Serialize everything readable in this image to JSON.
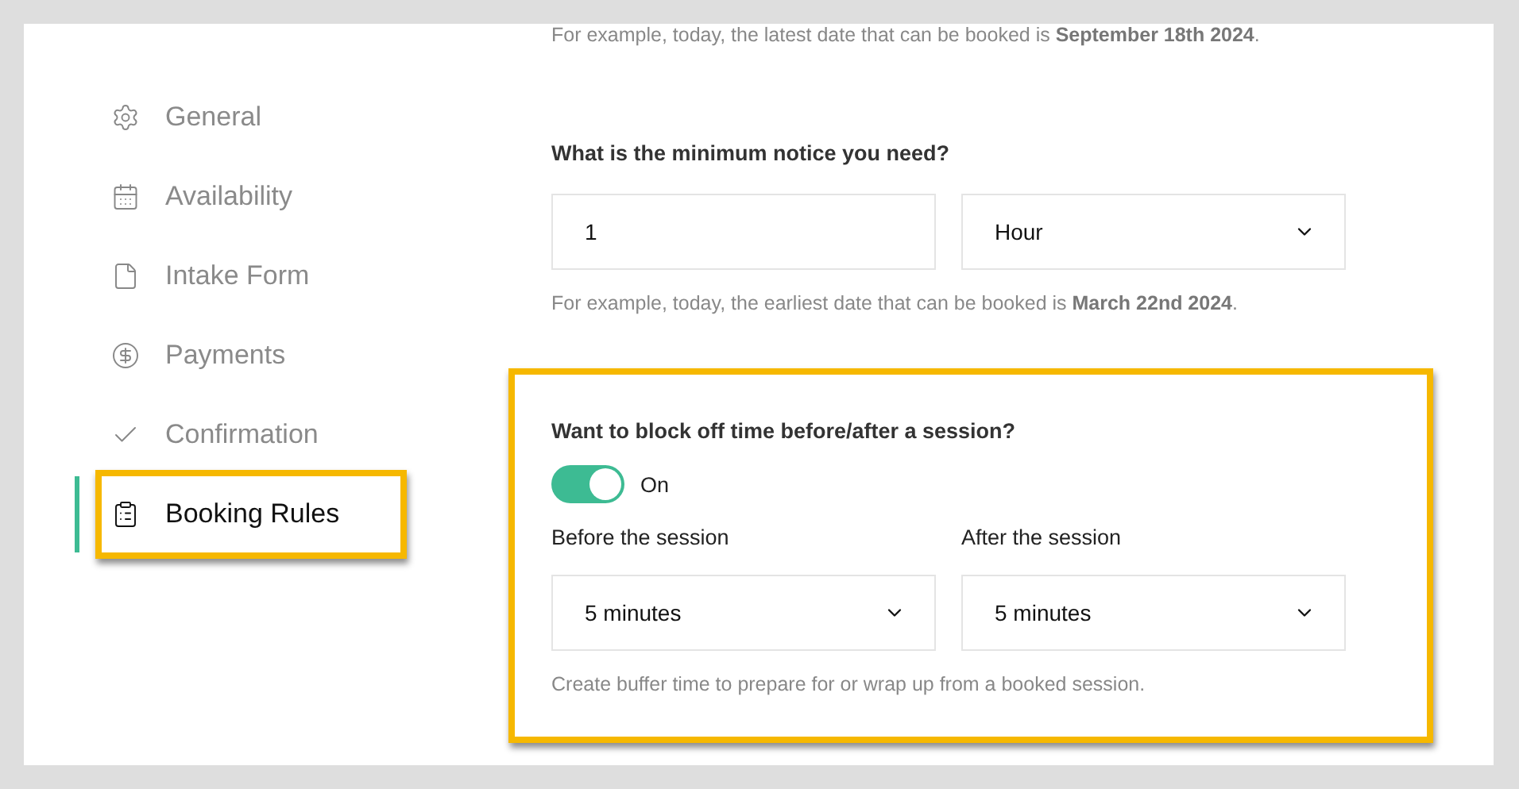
{
  "sidebar": {
    "items": [
      {
        "label": "General",
        "selected": false,
        "highlighted": false
      },
      {
        "label": "Availability",
        "selected": false,
        "highlighted": false
      },
      {
        "label": "Intake Form",
        "selected": false,
        "highlighted": false
      },
      {
        "label": "Payments",
        "selected": false,
        "highlighted": false
      },
      {
        "label": "Confirmation",
        "selected": false,
        "highlighted": false
      },
      {
        "label": "Booking Rules",
        "selected": true,
        "highlighted": true
      }
    ]
  },
  "latest_note": "For example, today, the latest date that can be booked is **September 18th 2024**.",
  "minimum_notice": {
    "question": "What is the minimum notice you need?",
    "amount": "1",
    "unit": "Hour",
    "note": "For example, today, the earliest date that can be booked is **March 22nd 2024**."
  },
  "buffer": {
    "highlighted": true,
    "question": "Want to block off time before/after a session?",
    "toggle": {
      "on": true,
      "label": "On"
    },
    "fields": [
      {
        "label": "Before the session",
        "value": "5 minutes"
      },
      {
        "label": "After the session",
        "value": "5 minutes"
      }
    ],
    "hint": "Create buffer time to prepare for or wrap up from a booked session."
  }
}
